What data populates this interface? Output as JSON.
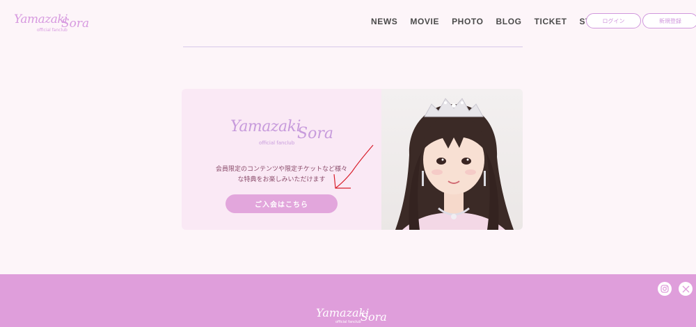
{
  "header": {
    "logo": {
      "main": "Yamazaki",
      "second": "Sora",
      "sub": "official fanclub"
    },
    "nav": [
      "NEWS",
      "MOVIE",
      "PHOTO",
      "BLOG",
      "TICKET",
      "STORE"
    ],
    "login_label": "ログイン",
    "register_label": "新規登録"
  },
  "card": {
    "logo": {
      "main": "Yamazaki",
      "second": "Sora",
      "sub": "official fanclub"
    },
    "description_line1": "会員限定のコンテンツや限定チケットなど様々",
    "description_line2": "な特典をお楽しみいただけます",
    "join_label": "ご入会はこちら"
  },
  "footer": {
    "logo": {
      "main": "Yamazaki",
      "second": "Sora",
      "sub": "official fanclub"
    },
    "social": [
      "instagram-icon",
      "x-icon"
    ]
  },
  "colors": {
    "accent": "#df9edb",
    "logo": "#d79ae0",
    "background": "#fdf5f9",
    "annotation_arrow": "#d81e2a"
  }
}
